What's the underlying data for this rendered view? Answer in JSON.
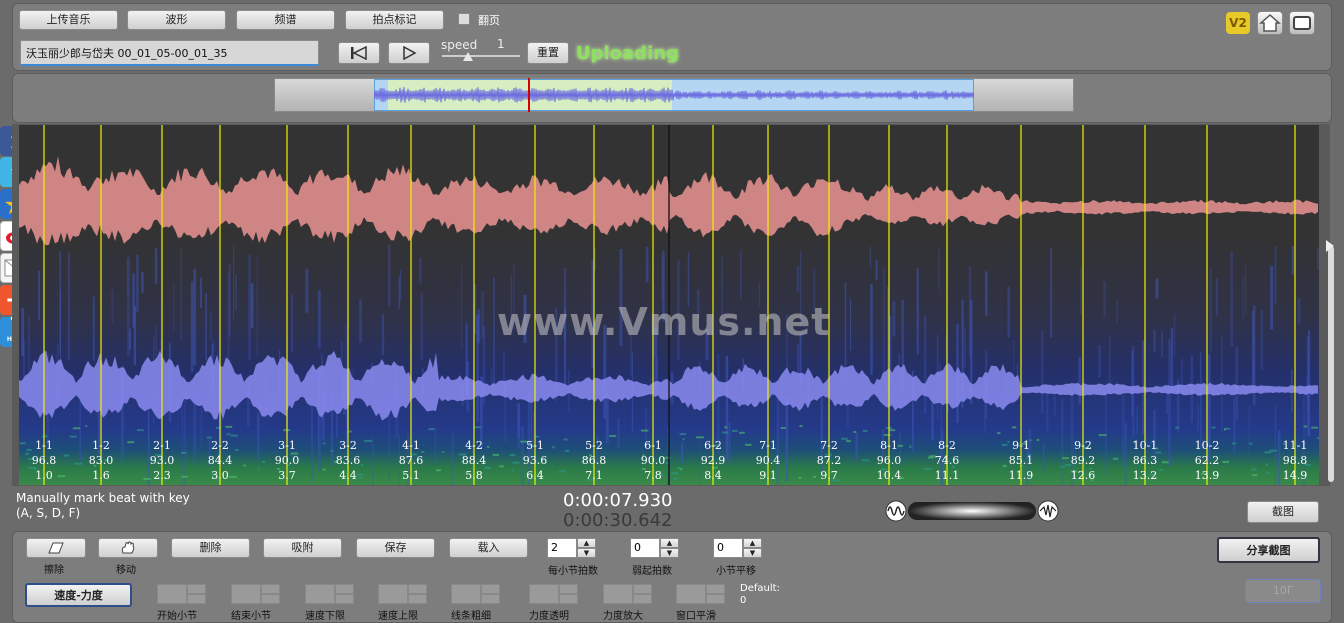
{
  "toolbar": {
    "upload_music": "上传音乐",
    "waveform": "波形",
    "spectrum": "频谱",
    "tap_mark": "拍点标记",
    "flip_page": "翻页",
    "flip_checked": false
  },
  "track": {
    "filename": "沃玉丽少郎与岱夫 00_01_05-00_01_35",
    "speed_label": "speed",
    "speed_value": "1",
    "reset_label": "重置",
    "status": "Uploading"
  },
  "top_right": {
    "v2": "V2"
  },
  "watermark": "www.Vmus.net",
  "beats": [
    {
      "label": "1-1",
      "bpm": "96.8",
      "time": "1.0"
    },
    {
      "label": "1-2",
      "bpm": "83.0",
      "time": "1.6"
    },
    {
      "label": "2-1",
      "bpm": "93.0",
      "time": "2.3"
    },
    {
      "label": "2-2",
      "bpm": "84.4",
      "time": "3.0"
    },
    {
      "label": "3-1",
      "bpm": "90.0",
      "time": "3.7"
    },
    {
      "label": "3-2",
      "bpm": "83.6",
      "time": "4.4"
    },
    {
      "label": "4-1",
      "bpm": "87.6",
      "time": "5.1"
    },
    {
      "label": "4-2",
      "bpm": "88.4",
      "time": "5.8"
    },
    {
      "label": "5-1",
      "bpm": "93.6",
      "time": "6.4"
    },
    {
      "label": "5-2",
      "bpm": "86.8",
      "time": "7.1"
    },
    {
      "label": "6-1",
      "bpm": "90.0",
      "time": "7.8"
    },
    {
      "label": "6-2",
      "bpm": "92.9",
      "time": "8.4"
    },
    {
      "label": "7-1",
      "bpm": "90.4",
      "time": "9.1"
    },
    {
      "label": "7-2",
      "bpm": "87.2",
      "time": "9.7"
    },
    {
      "label": "8-1",
      "bpm": "96.0",
      "time": "10.4"
    },
    {
      "label": "8-2",
      "bpm": "74.6",
      "time": "11.1"
    },
    {
      "label": "9-1",
      "bpm": "85.1",
      "time": "11.9"
    },
    {
      "label": "9-2",
      "bpm": "89.2",
      "time": "12.6"
    },
    {
      "label": "10-1",
      "bpm": "86.3",
      "time": "13.2"
    },
    {
      "label": "10-2",
      "bpm": "62.2",
      "time": "13.9"
    },
    {
      "label": "11-1",
      "bpm": "98.8",
      "time": "14.9"
    }
  ],
  "hint": {
    "line1": "Manually mark beat with key",
    "line2": "(A, S, D, F)"
  },
  "time": {
    "current": "0:00:07.930",
    "total": "0:00:30.642"
  },
  "screenshot_button": "截图",
  "share_button": "分享截图",
  "disabled_button": "10Γ",
  "tools": {
    "erase": "擦除",
    "move": "移动",
    "delete": "删除",
    "snap": "吸附",
    "save": "保存",
    "load": "载入"
  },
  "spinners": {
    "beats_per_bar": {
      "value": "2",
      "label": "每小节拍数"
    },
    "pickup": {
      "value": "0",
      "label": "弱起拍数"
    },
    "bar_shift": {
      "value": "0",
      "label": "小节平移"
    }
  },
  "mode_button": "速度-力度",
  "lower_labels": [
    "开始小节",
    "结束小节",
    "速度下限",
    "速度上限",
    "线条粗细",
    "力度透明",
    "力度放大",
    "窗口平滑"
  ],
  "default_label": "Default:",
  "default_value": "0",
  "colors": {
    "waveform_top": "#d98a8a",
    "waveform_bottom": "#8b8bf0",
    "beat_line": "#f0f000",
    "status": "#8ee060"
  }
}
